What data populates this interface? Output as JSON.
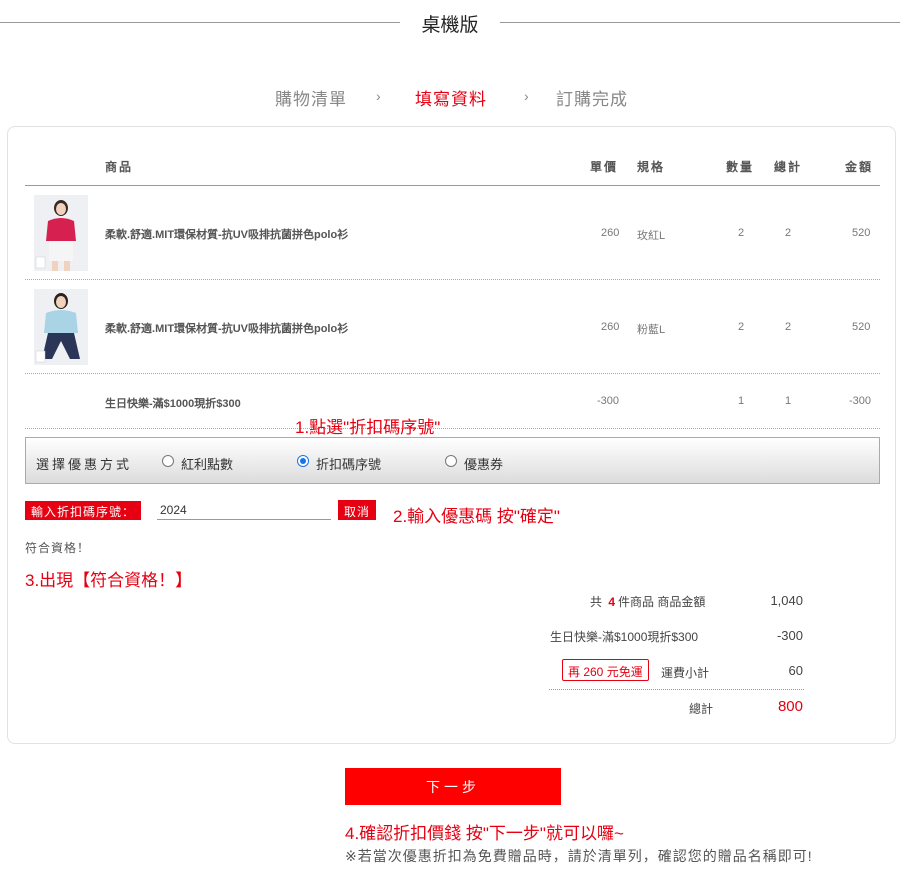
{
  "header": {
    "title": "桌機版"
  },
  "steps": [
    {
      "label": "購物清單",
      "active": false
    },
    {
      "label": "填寫資料",
      "active": true
    },
    {
      "label": "訂購完成",
      "active": false
    }
  ],
  "step_arrow": "›",
  "table": {
    "columns": {
      "product": "商品",
      "price": "單價",
      "spec": "規格",
      "qty": "數量",
      "subtotal": "總計",
      "amount": "金額"
    },
    "rows": [
      {
        "name": "柔軟.舒適.MIT環保材質-抗UV吸排抗菌拼色polo衫",
        "price": "260",
        "spec": "玫紅L",
        "qty": "2",
        "total": "2",
        "amount": "520"
      },
      {
        "name": "柔軟.舒適.MIT環保材質-抗UV吸排抗菌拼色polo衫",
        "price": "260",
        "spec": "粉藍L",
        "qty": "2",
        "total": "2",
        "amount": "520"
      },
      {
        "name": "生日快樂-滿$1000現折$300",
        "price": "-300",
        "spec": "",
        "qty": "1",
        "total": "1",
        "amount": "-300"
      }
    ]
  },
  "notes": {
    "n1": "1.點選\"折扣碼序號\"",
    "n2": "2.輸入優惠碼 按\"確定\"",
    "n3": "3.出現【符合資格！】",
    "n4": "4.確認折扣價錢 按\"下一步\"就可以囉~"
  },
  "discount": {
    "label": "選擇優惠方式",
    "options": [
      {
        "label": "紅利點數",
        "selected": false
      },
      {
        "label": "折扣碼序號",
        "selected": true
      },
      {
        "label": "優惠券",
        "selected": false
      }
    ],
    "code_label": "輸入折扣碼序號：",
    "code_value": "2024",
    "cancel_label": "取消",
    "qualify_text": "符合資格！"
  },
  "summary": {
    "count_prefix": "共",
    "count": "4",
    "count_suffix": "件商品 商品金額",
    "goods_amount": "1,040",
    "promo_label": "生日快樂-滿$1000現折$300",
    "promo_amount": "-300",
    "free_shipping_tag": "再 260 元免運",
    "shipping_label": "運費小計",
    "shipping_amount": "60",
    "total_label": "總計",
    "total_amount": "800"
  },
  "next_button": "下一步",
  "footer_note": "※若當次優惠折扣為免費贈品時，請於清單列，確認您的贈品名稱即可!",
  "colors": {
    "accent": "#e60012",
    "button": "#ff0000",
    "radio": "#1a73e8"
  }
}
